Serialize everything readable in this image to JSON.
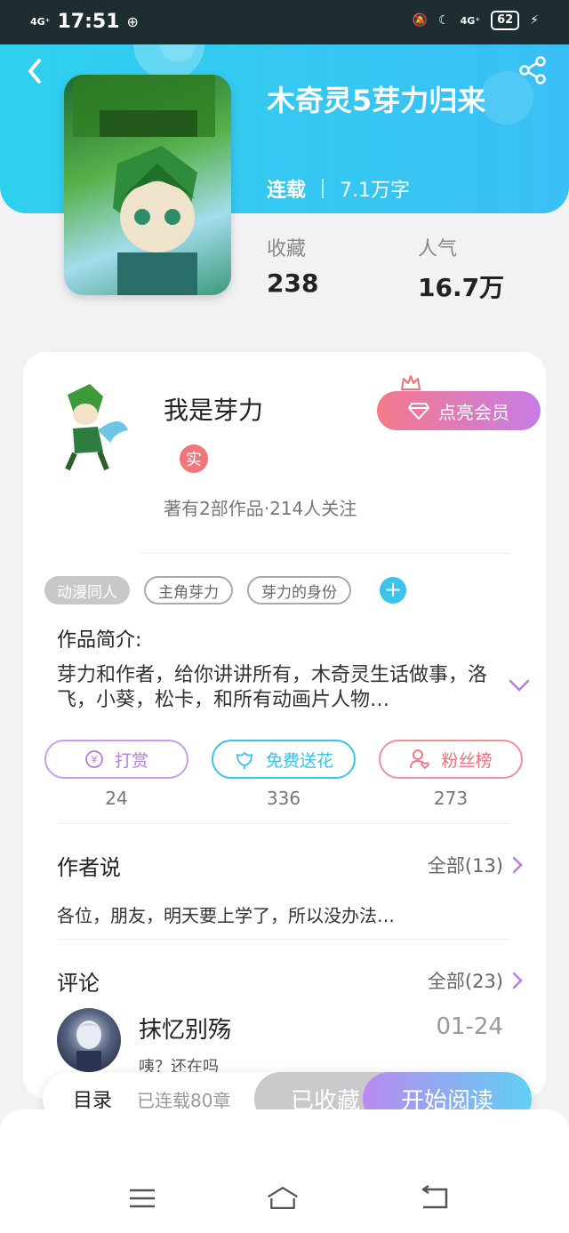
{
  "status_bar": {
    "network_left": "4G⁺",
    "time": "17:51",
    "network_right": "4G⁺",
    "battery": "62"
  },
  "book": {
    "title": "木奇灵5芽力归来",
    "status": "连载",
    "word_count": "7.1万字",
    "favorites_label": "收藏",
    "favorites_value": "238",
    "popularity_label": "人气",
    "popularity_value": "16.7万"
  },
  "author": {
    "name": "我是芽力",
    "real_badge": "实",
    "info": "著有2部作品·214人关注",
    "vip_button": "点亮会员"
  },
  "tags": [
    "动漫同人",
    "主角芽力",
    "芽力的身份"
  ],
  "intro": {
    "title": "作品简介:",
    "text": "芽力和作者，给你讲讲所有，木奇灵生话做事，洛飞，小葵，松卡，和所有动画片人物…"
  },
  "actions": [
    {
      "label": "打赏",
      "count": "24",
      "color": "#b77ee0"
    },
    {
      "label": "免费送花",
      "count": "336",
      "color": "#3bc3ec"
    },
    {
      "label": "粉丝榜",
      "count": "273",
      "color": "#f0707a"
    }
  ],
  "author_say": {
    "title": "作者说",
    "more": "全部(13)",
    "text": "各位，朋友，明天要上学了，所以没办法…"
  },
  "comments": {
    "title": "评论",
    "more": "全部(23)",
    "items": [
      {
        "name": "抹忆别殇",
        "date": "01-24",
        "text": "咦？还在吗"
      }
    ]
  },
  "bottom_bar": {
    "toc": "目录",
    "chapters": "已连载80章",
    "favorited": "已收藏",
    "read": "开始阅读"
  },
  "colors": {
    "accent_blue": "#3bc3ec",
    "accent_purple": "#b77ee0",
    "accent_pink": "#f0707a"
  }
}
